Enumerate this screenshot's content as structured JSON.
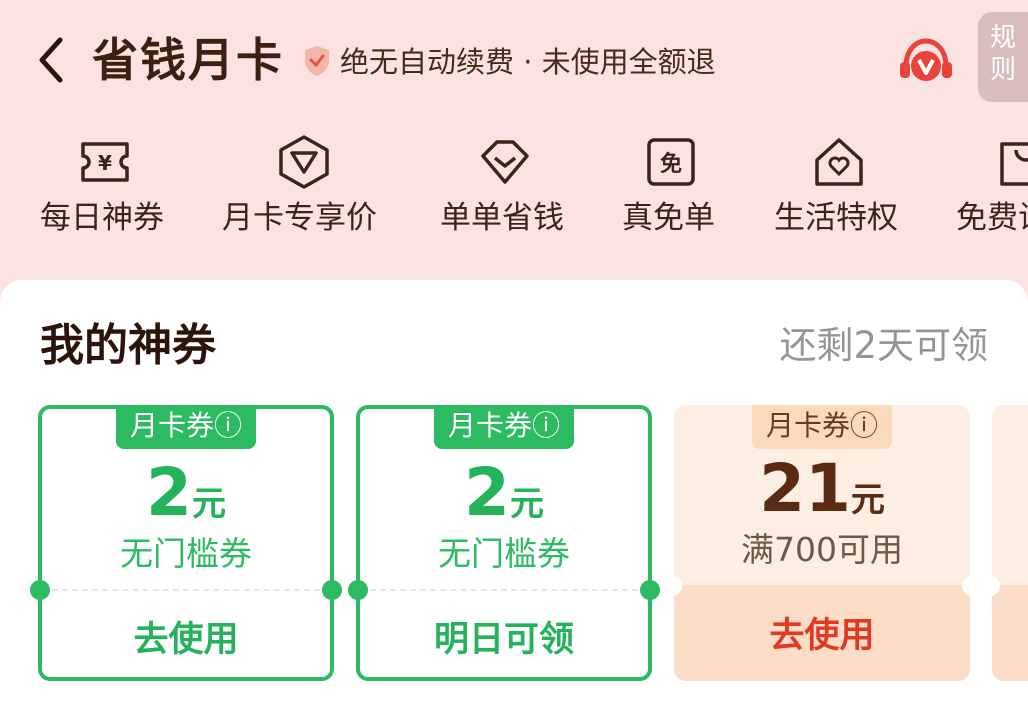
{
  "header": {
    "title": "省钱月卡",
    "subtitle": "绝无自动续费 · 未使用全额退",
    "rules_label": "规则"
  },
  "nav": [
    {
      "label": "每日神券",
      "icon": "yen-ticket-icon"
    },
    {
      "label": "月卡专享价",
      "icon": "v-badge-icon"
    },
    {
      "label": "单单省钱",
      "icon": "heart-pouch-icon"
    },
    {
      "label": "真免单",
      "icon": "free-order-icon"
    },
    {
      "label": "生活特权",
      "icon": "house-heart-icon"
    },
    {
      "label": "免费试",
      "icon": "bag-icon"
    }
  ],
  "section": {
    "title": "我的神券",
    "remain": "还剩2天可领"
  },
  "coupons": [
    {
      "tag": "月卡券ⓘ",
      "amount": "2",
      "unit": "元",
      "desc": "无门槛券",
      "action": "去使用",
      "style": "green"
    },
    {
      "tag": "月卡券ⓘ",
      "amount": "2",
      "unit": "元",
      "desc": "无门槛券",
      "action": "明日可领",
      "style": "green"
    },
    {
      "tag": "月卡券ⓘ",
      "amount": "21",
      "unit": "元",
      "desc": "满700可用",
      "action": "去使用",
      "style": "peach"
    }
  ],
  "colors": {
    "header_bg": "#fbe3e2",
    "accent_green": "#2dbb62",
    "accent_red": "#e03a25",
    "title_brown": "#3e1f12"
  }
}
